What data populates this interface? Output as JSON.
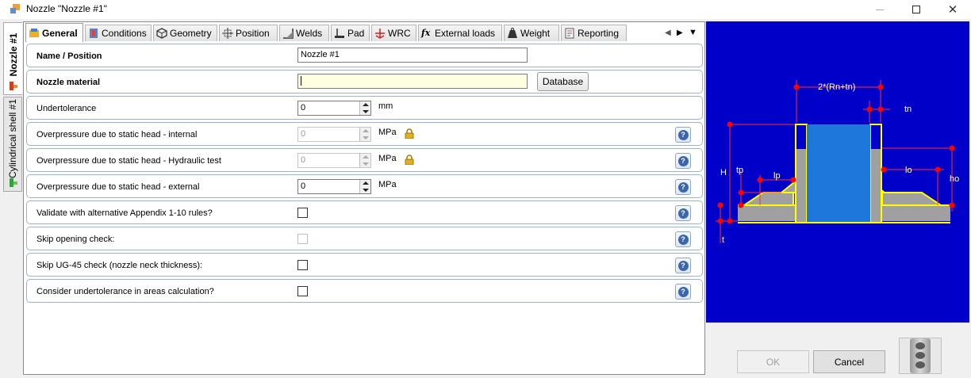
{
  "window": {
    "title": "Nozzle \"Nozzle #1\"",
    "controls": [
      "minimize-icon",
      "maximize-icon",
      "close-icon"
    ]
  },
  "side_tabs": [
    {
      "label": "Nozzle #1",
      "icon": "nozzle-icon",
      "active": true
    },
    {
      "label": "Cylindrical shell #1",
      "icon": "shell-icon",
      "active": false
    }
  ],
  "tabs": [
    {
      "label": "General",
      "icon": "general-icon",
      "active": true
    },
    {
      "label": "Conditions",
      "icon": "conditions-icon"
    },
    {
      "label": "Geometry",
      "icon": "geometry-icon"
    },
    {
      "label": "Position",
      "icon": "position-icon"
    },
    {
      "label": "Welds",
      "icon": "welds-icon"
    },
    {
      "label": "Pad",
      "icon": "pad-icon"
    },
    {
      "label": "WRC",
      "icon": "wrc-icon"
    },
    {
      "label": "External loads",
      "icon": "fx-icon"
    },
    {
      "label": "Weight",
      "icon": "weight-icon"
    },
    {
      "label": "Reporting",
      "icon": "reporting-icon"
    }
  ],
  "tab_nav": [
    "scroll-left-icon",
    "scroll-right-icon",
    "tab-list-icon"
  ],
  "rows": [
    {
      "label": "Name / Position",
      "bold": true,
      "control": "text",
      "value": "Nozzle #1"
    },
    {
      "label": "Nozzle material",
      "bold": true,
      "control": "text",
      "value": "",
      "highlight": "#ffffe1",
      "button": "Database"
    },
    {
      "label": "Undertolerance",
      "control": "spin",
      "value": "0",
      "unit": "mm"
    },
    {
      "label": "Overpressure due to static head - internal",
      "control": "spin",
      "value": "0",
      "unit": "MPa",
      "disabled": true,
      "locked": true,
      "help": true
    },
    {
      "label": "Overpressure due to static head - Hydraulic test",
      "control": "spin",
      "value": "0",
      "unit": "MPa",
      "disabled": true,
      "locked": true,
      "help": true
    },
    {
      "label": "Overpressure due to static head - external",
      "control": "spin",
      "value": "0",
      "unit": "MPa",
      "help": true
    },
    {
      "label": "Validate with alternative Appendix 1-10 rules?",
      "control": "checkbox",
      "checked": false,
      "help": true
    },
    {
      "label": "Skip opening check:",
      "control": "checkbox",
      "checked": false,
      "disabled": true,
      "help": true
    },
    {
      "label": "Skip UG-45 check (nozzle neck thickness):",
      "control": "checkbox",
      "checked": false,
      "help": true
    },
    {
      "label": "Consider undertolerance in areas calculation?",
      "control": "checkbox",
      "checked": false,
      "help": true
    }
  ],
  "diagram": {
    "background": "#0000c8",
    "labels": {
      "diameter": "2*(Rn+tn)",
      "tn": "tn",
      "H": "H",
      "tp": "tp",
      "lp": "lp",
      "lo": "lo",
      "ho": "ho",
      "t": "t"
    }
  },
  "buttons": {
    "ok": "OK",
    "cancel": "Cancel"
  },
  "status_icon": "traffic-light-icon",
  "colors": {
    "accent_border": "#9bb3cc",
    "diagram_outline": "#ffff00",
    "diagram_nozzle": "#1e78dc",
    "dimension_marker": "#ff0000"
  }
}
